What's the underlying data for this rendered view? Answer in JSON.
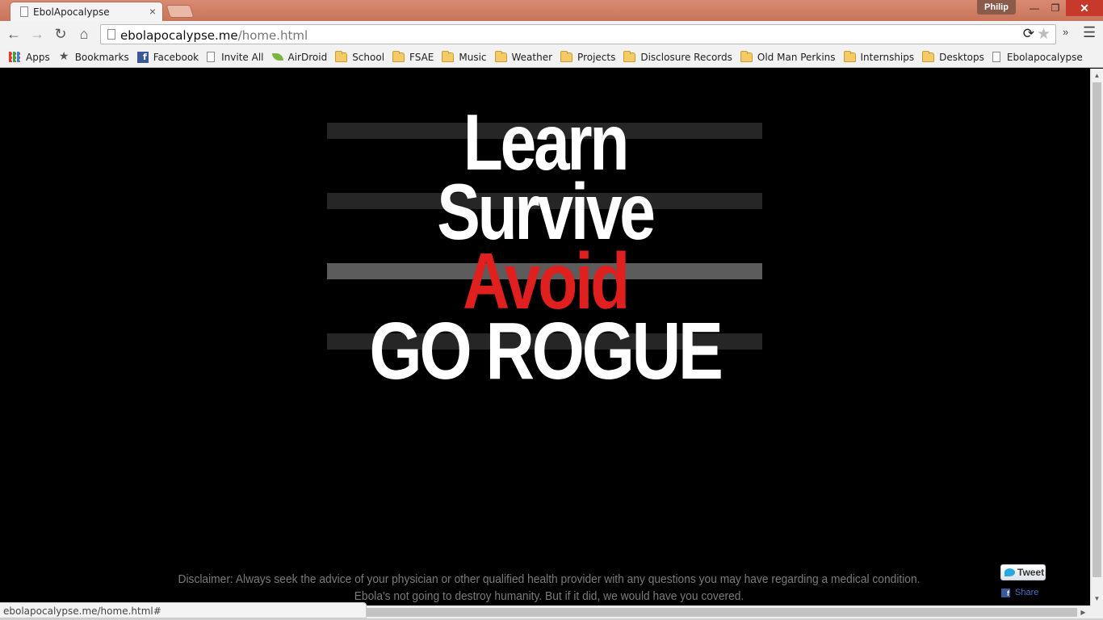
{
  "window": {
    "tab_title": "EbolApocalypse",
    "tab_close": "×",
    "profile_name": "Philip",
    "min_symbol": "—",
    "max_symbol": "❐",
    "close_symbol": "✕"
  },
  "toolbar": {
    "back_icon": "←",
    "forward_icon": "→",
    "reload_icon": "↻",
    "home_icon": "⌂",
    "url_host": "ebolapocalypse.me",
    "url_path": "/home.html",
    "sync_icon": "⟳",
    "star_icon": "★",
    "chevron_icon": "»",
    "menu_icon": "☰"
  },
  "bookmarks": [
    {
      "label": "Apps",
      "icon": "apps-grid-icon"
    },
    {
      "label": "Bookmarks",
      "icon": "star-icon"
    },
    {
      "label": "Facebook",
      "icon": "facebook-icon"
    },
    {
      "label": "Invite All",
      "icon": "page-icon"
    },
    {
      "label": "AirDroid",
      "icon": "airdroid-icon"
    },
    {
      "label": "School",
      "icon": "folder-icon"
    },
    {
      "label": "FSAE",
      "icon": "folder-icon"
    },
    {
      "label": "Music",
      "icon": "folder-icon"
    },
    {
      "label": "Weather",
      "icon": "folder-icon"
    },
    {
      "label": "Projects",
      "icon": "folder-icon"
    },
    {
      "label": "Disclosure Records",
      "icon": "folder-icon"
    },
    {
      "label": "Old Man Perkins",
      "icon": "folder-icon"
    },
    {
      "label": "Internships",
      "icon": "folder-icon"
    },
    {
      "label": "Desktops",
      "icon": "folder-icon"
    },
    {
      "label": "Ebolapocalypse",
      "icon": "page-icon"
    }
  ],
  "hero": {
    "line1": "Learn",
    "line2": "Survive",
    "line3": "Avoid",
    "line4": "GO ROGUE",
    "colors": {
      "text": "#ffffff",
      "accent": "#e01f1f",
      "stripe_dark": "#262626",
      "stripe_light": "#5c5c5c"
    }
  },
  "disclaimer": {
    "line1": "Disclaimer: Always seek the advice of your physician or other qualified health provider with any questions you may have regarding a medical condition.",
    "line2": "Ebola's not going to destroy humanity. But if it did, we would have you covered."
  },
  "social": {
    "tweet_label": "Tweet",
    "share_label": "Share"
  },
  "status_bar": {
    "url": "ebolapocalypse.me/home.html#"
  },
  "scrollbar": {
    "up_arrow": "▲",
    "down_arrow": "▼",
    "right_arrow": "▶"
  }
}
